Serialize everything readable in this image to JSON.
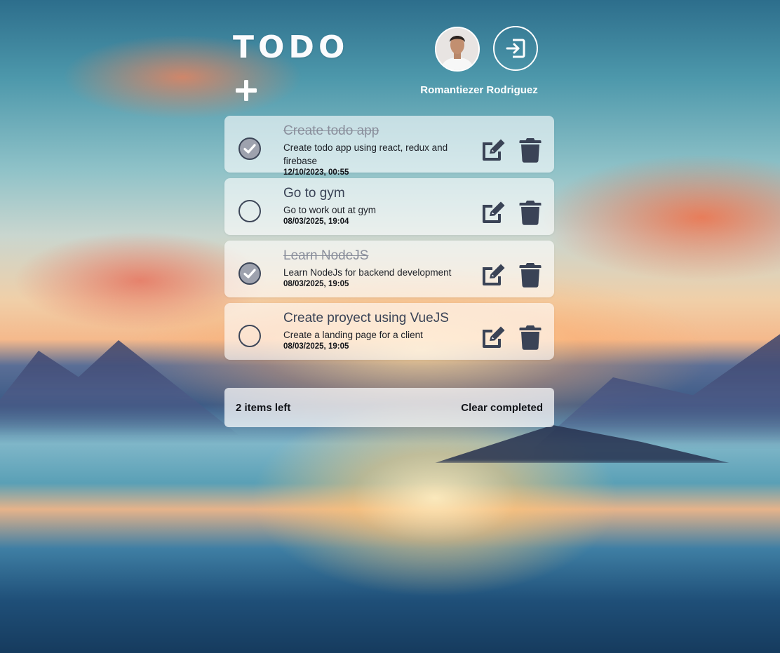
{
  "app": {
    "title": "TODO"
  },
  "user": {
    "name": "Romantiezer Rodriguez"
  },
  "todos": [
    {
      "title": "Create todo app",
      "description": "Create todo app using react, redux and firebase",
      "date": "12/10/2023, 00:55",
      "completed": true
    },
    {
      "title": "Go to gym",
      "description": "Go to work out at gym",
      "date": "08/03/2025, 19:04",
      "completed": false
    },
    {
      "title": "Learn NodeJS",
      "description": "Learn NodeJs for backend development",
      "date": "08/03/2025, 19:05",
      "completed": true
    },
    {
      "title": "Create proyect using VueJS",
      "description": "Create a landing page for a client",
      "date": "08/03/2025, 19:05",
      "completed": false
    }
  ],
  "footer": {
    "items_left": "2 items left",
    "clear_label": "Clear completed"
  },
  "icons": {
    "add": "plus-icon",
    "logout": "logout-icon",
    "check": "check-icon",
    "edit": "edit-icon",
    "delete": "trash-icon"
  },
  "colors": {
    "icon_dark": "#3a4356",
    "completed_check_fill": "#9ea2ae"
  }
}
